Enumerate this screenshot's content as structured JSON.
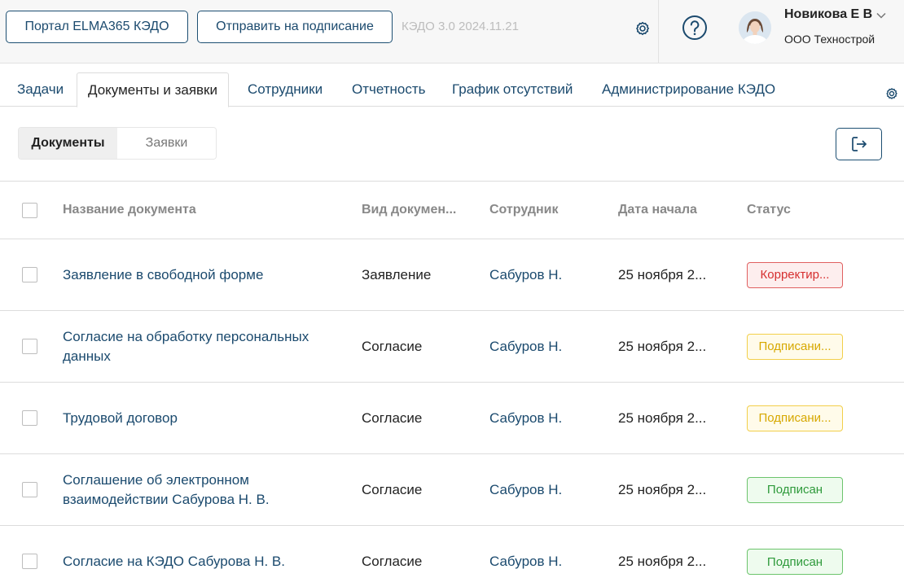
{
  "header": {
    "portal_button": "Портал ELMA365 КЭДО",
    "send_button": "Отправить на подписание",
    "version": "КЭДО 3.0 2024.11.21",
    "user_name": "Новикова Е В",
    "company": "ООО Технострой"
  },
  "tabs": [
    {
      "label": "Задачи",
      "active": false
    },
    {
      "label": "Документы и заявки",
      "active": true
    },
    {
      "label": "Сотрудники",
      "active": false
    },
    {
      "label": "Отчетность",
      "active": false
    },
    {
      "label": "График отсутствий",
      "active": false
    },
    {
      "label": "Администрирование КЭДО",
      "active": false
    }
  ],
  "segment": {
    "documents": "Документы",
    "requests": "Заявки"
  },
  "table": {
    "columns": {
      "name": "Название документа",
      "type": "Вид докумен...",
      "employee": "Сотрудник",
      "start_date": "Дата начала",
      "status": "Статус"
    },
    "rows": [
      {
        "name": "Заявление в свободной форме",
        "type": "Заявление",
        "employee": "Сабуров Н.",
        "start_date": "25 ноября 2...",
        "status": "Корректир...",
        "status_tone": "red"
      },
      {
        "name": "Согласие на обработку персональных данных",
        "type": "Согласие",
        "employee": "Сабуров Н.",
        "start_date": "25 ноября 2...",
        "status": "Подписани...",
        "status_tone": "yellow"
      },
      {
        "name": "Трудовой договор",
        "type": "Согласие",
        "employee": "Сабуров Н.",
        "start_date": "25 ноября 2...",
        "status": "Подписани...",
        "status_tone": "yellow"
      },
      {
        "name": "Соглашение об электронном взаимодействии Сабурова Н. В.",
        "type": "Согласие",
        "employee": "Сабуров Н.",
        "start_date": "25 ноября 2...",
        "status": "Подписан",
        "status_tone": "green"
      },
      {
        "name": "Согласие на КЭДО Сабурова Н. В.",
        "type": "Согласие",
        "employee": "Сабуров Н.",
        "start_date": "25 ноября 2...",
        "status": "Подписан",
        "status_tone": "green"
      }
    ]
  },
  "colors": {
    "accent": "#1b4a6e",
    "status_red": "#d62f2f",
    "status_yellow": "#d7a800",
    "status_green": "#2e9a3b"
  },
  "icons": {
    "header_settings": "gear-icon",
    "help": "help-icon",
    "user_menu": "chevron-down-icon",
    "tabs_settings": "gear-icon",
    "export": "export-icon"
  }
}
